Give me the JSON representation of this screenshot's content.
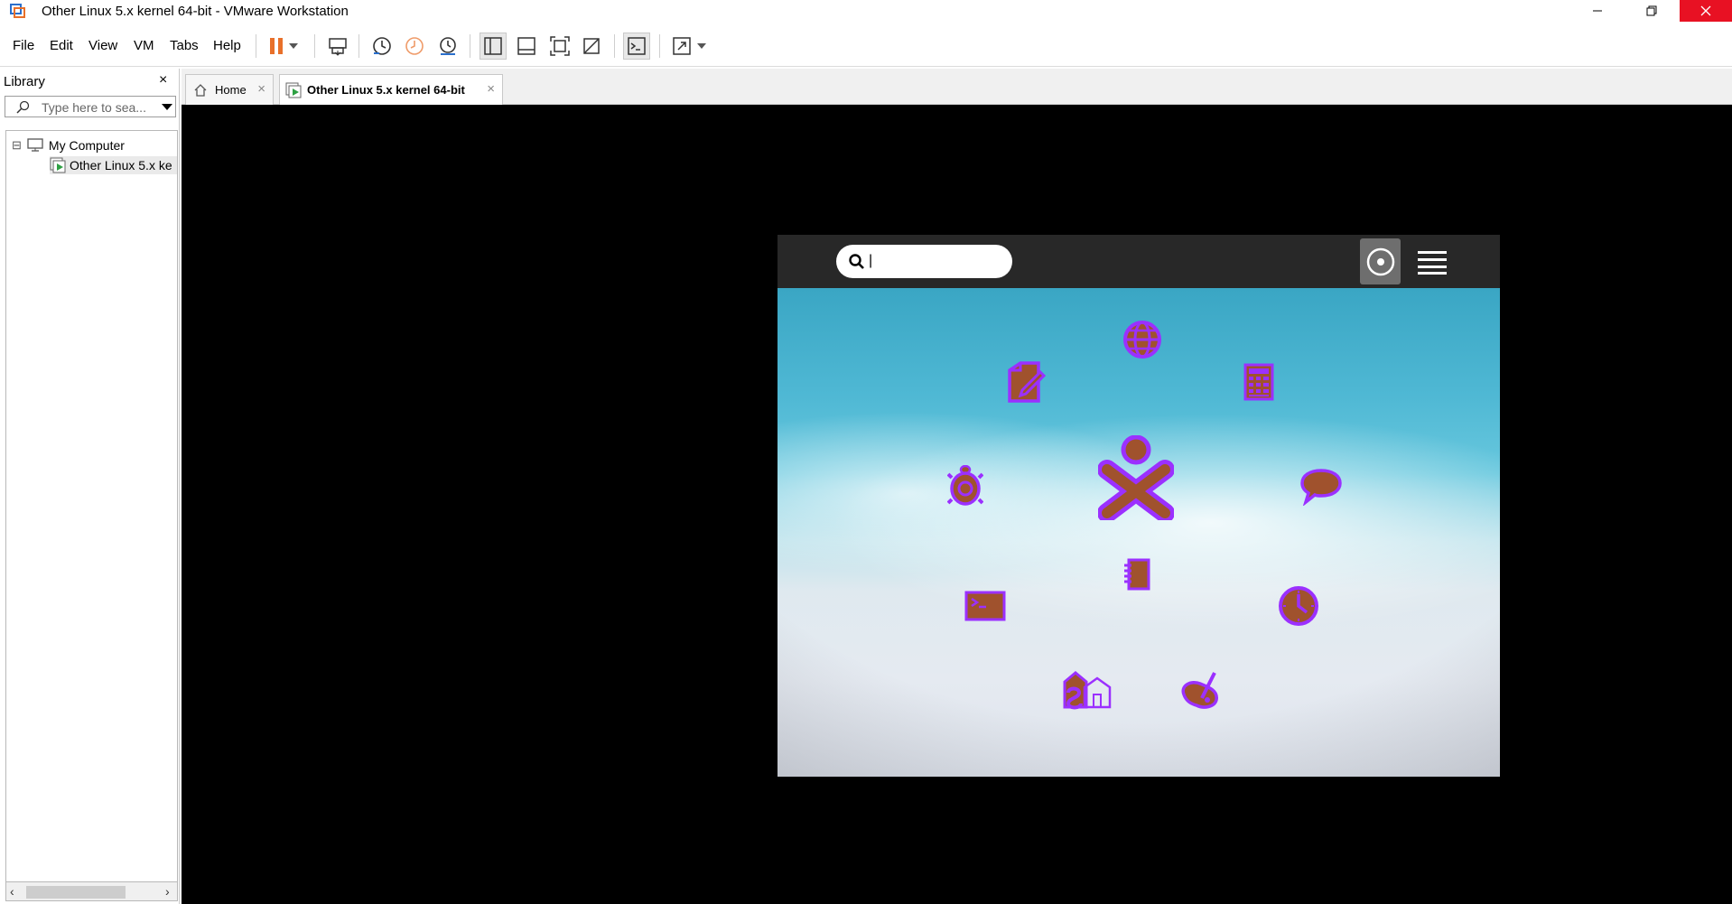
{
  "window": {
    "title": "Other Linux 5.x kernel 64-bit - VMware Workstation",
    "close_color": "#e81123"
  },
  "menu": {
    "items": [
      "File",
      "Edit",
      "View",
      "VM",
      "Tabs",
      "Help"
    ]
  },
  "toolbar": {
    "icons": [
      "pause-icon",
      "dropdown-icon",
      "send-ctrl-alt-del-icon",
      "snapshot-take-icon",
      "snapshot-revert-icon",
      "snapshot-manager-icon",
      "show-library-icon",
      "show-thumbnail-bar-icon",
      "fullscreen-icon",
      "unity-icon",
      "console-view-icon",
      "stretch-guest-icon",
      "dropdown-icon"
    ],
    "accent": "#e8702a"
  },
  "library": {
    "title": "Library",
    "close_label": "×",
    "search_placeholder": "Type here to sea...",
    "tree": {
      "root_toggle": "⊟",
      "root_label": "My Computer",
      "child_label": "Other Linux 5.x ke"
    }
  },
  "tabs": [
    {
      "label": "Home",
      "icon": "home-icon"
    },
    {
      "label": "Other Linux 5.x kernel 64-bit",
      "icon": "vm-running-icon",
      "active": true
    }
  ],
  "guest": {
    "search_value": "|",
    "top_icons": [
      "home-view-icon",
      "list-view-icon"
    ],
    "apps": [
      "browse-icon",
      "write-icon",
      "calculate-icon",
      "turtle-art-icon",
      "xo-owner-icon",
      "chat-icon",
      "journal-icon",
      "terminal-icon",
      "clock-icon",
      "school-server-icon",
      "paint-icon"
    ],
    "icon_fill": "#a0522d",
    "icon_stroke": "#9b30ff"
  }
}
